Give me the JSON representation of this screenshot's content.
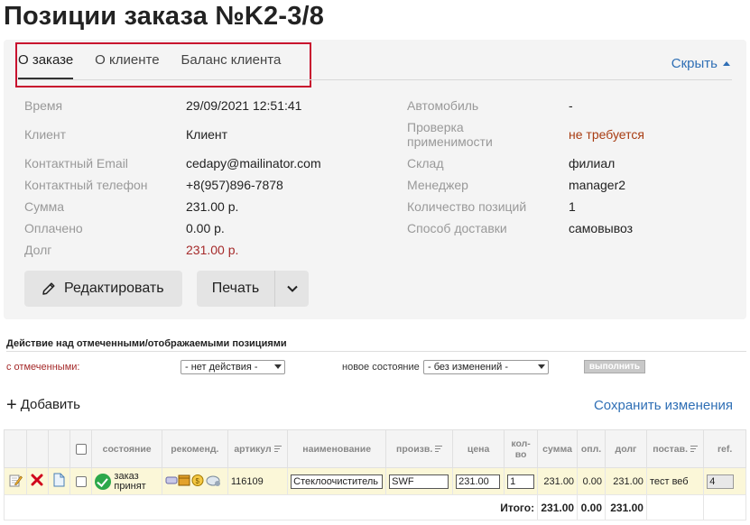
{
  "page": {
    "title": "Позиции заказа №K2-3/8"
  },
  "tabs": [
    {
      "label": "О заказе",
      "active": true
    },
    {
      "label": "О клиенте",
      "active": false
    },
    {
      "label": "Баланс клиента",
      "active": false
    }
  ],
  "hide_label": "Скрыть",
  "info_left": [
    {
      "label": "Время",
      "value": "29/09/2021 12:51:41"
    },
    {
      "label": "Клиент",
      "value": "Клиент"
    },
    {
      "label": "Контактный Email",
      "value": "cedapy@mailinator.com"
    },
    {
      "label": "Контактный телефон",
      "value": "+8(957)896-7878"
    },
    {
      "label": "Сумма",
      "value": "231.00 р."
    },
    {
      "label": "Оплачено",
      "value": "0.00 р."
    },
    {
      "label": "Долг",
      "value": "231.00 р."
    }
  ],
  "info_right": [
    {
      "label": "Автомобиль",
      "value": "-"
    },
    {
      "label": "Проверка применимости",
      "value": "не требуется"
    },
    {
      "label": "Склад",
      "value": "филиал"
    },
    {
      "label": "Менеджер",
      "value": "manager2"
    },
    {
      "label": "Количество позиций",
      "value": "1"
    },
    {
      "label": "Способ доставки",
      "value": "самовывоз"
    }
  ],
  "buttons": {
    "edit": "Редактировать",
    "print": "Печать"
  },
  "actions": {
    "title": "Действие над отмеченными/отображаемыми позициями",
    "with_marked": "с отмеченными:",
    "action_select": "- нет действия -",
    "new_state_label": "новое состояние",
    "state_select": "- без изменений -",
    "run": "выполнить"
  },
  "add_label": "Добавить",
  "save_label": "Сохранить изменения",
  "table": {
    "headers": {
      "state": "состояние",
      "recommend": "рекоменд.",
      "article": "артикул",
      "name": "наименование",
      "maker": "произв.",
      "price": "цена",
      "qty": "кол-во",
      "sum": "сумма",
      "paid": "опл.",
      "debt": "долг",
      "supplier": "постав.",
      "ref": "ref."
    },
    "row": {
      "state": "заказ принят",
      "article": "116109",
      "name": "Стеклоочиститель",
      "maker": "SWF",
      "price": "231.00",
      "qty": "1",
      "sum": "231.00",
      "paid": "0.00",
      "debt": "231.00",
      "supplier": "тест веб",
      "ref": "4"
    },
    "total": {
      "label": "Итого:",
      "sum": "231.00",
      "paid": "0.00",
      "debt": "231.00"
    }
  },
  "colors": {
    "accent": "#2f6fb5",
    "debt": "#a52a2a",
    "tab_outline": "#c8102e",
    "ok": "#2ca84a"
  }
}
